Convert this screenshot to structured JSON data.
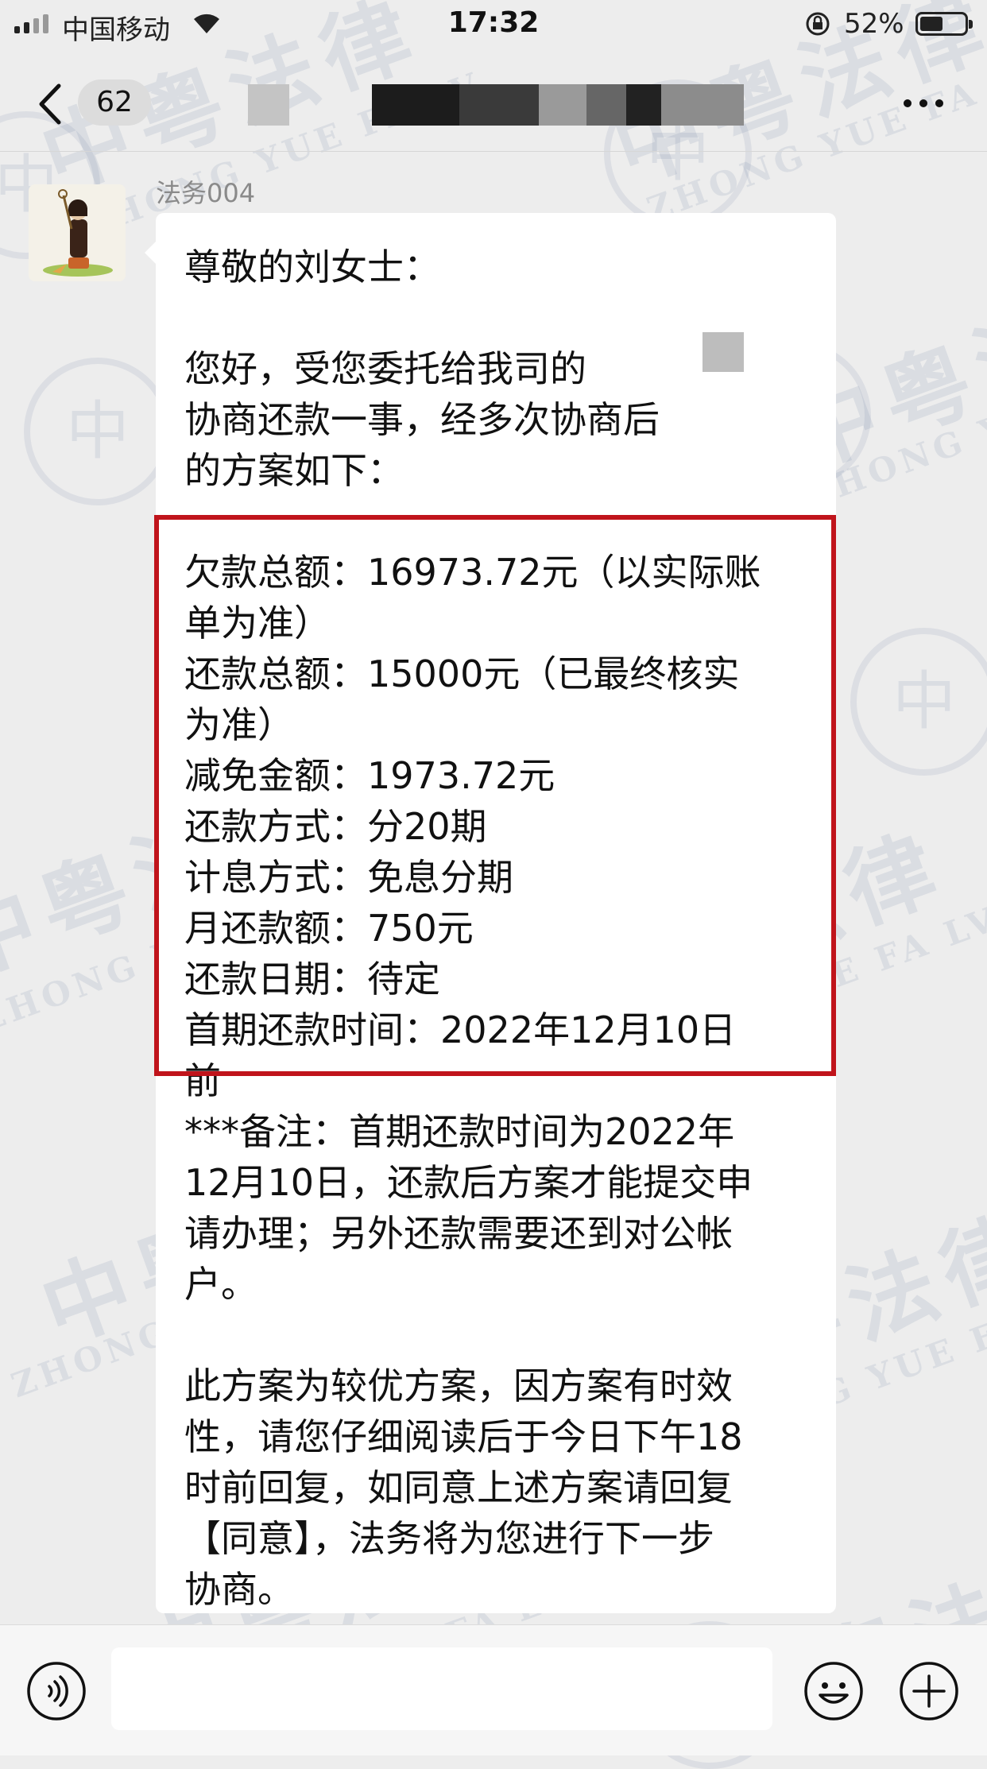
{
  "status_bar": {
    "carrier": "中国移动",
    "time": "17:32",
    "battery": "52%",
    "battery_level": 0.52
  },
  "nav": {
    "unread_count": "62"
  },
  "chat": {
    "sender": "法务004",
    "lines": [
      "尊敬的刘女士：",
      "",
      "您好，受您委托给我司的",
      "      协商还款一事，经多次协商后",
      "的方案如下：",
      "",
      "欠款总额：16973.72元（以实际账",
      "单为准）",
      "还款总额：15000元（已最终核实",
      "为准）",
      "减免金额：1973.72元",
      "还款方式：分20期",
      "计息方式：免息分期",
      "月还款额：750元",
      "还款日期：待定",
      "首期还款时间：2022年12月10日",
      "前",
      "***备注：首期还款时间为2022年",
      "12月10日，还款后方案才能提交申",
      "请办理；另外还款需要还到对公帐",
      "户。",
      "",
      "此方案为较优方案，因方案有时效",
      "性，请您仔细阅读后于今日下午18",
      "时前回复，如同意上述方案请回复",
      "【同意】，法务将为您进行下一步",
      "协商。"
    ]
  },
  "watermark": {
    "cn": "中粤法律",
    "en": "ZHONG YUE FA LV"
  },
  "colors": {
    "highlight_box": "#c0141b",
    "background": "#ededed",
    "bubble": "#ffffff"
  },
  "icons": {
    "back": "back-chevron-icon",
    "more": "more-icon",
    "voice": "voice-icon",
    "emoji": "emoji-icon",
    "plus": "plus-icon"
  }
}
